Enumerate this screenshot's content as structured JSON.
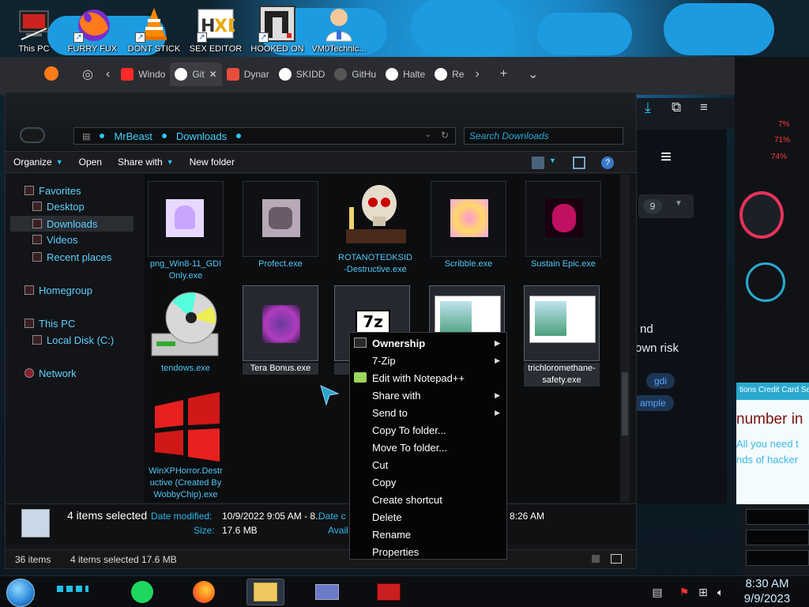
{
  "desktop": {
    "icons": [
      {
        "label": "This PC"
      },
      {
        "label": "FURRY FUX"
      },
      {
        "label": "DONT STICK"
      },
      {
        "label": "SEX EDITOR"
      },
      {
        "label": "HOOKED ON"
      },
      {
        "label": "VM0Technic..."
      }
    ]
  },
  "browser": {
    "tabs": [
      {
        "label": "Windo",
        "color": "#ff2a2a"
      },
      {
        "label": "Git",
        "color": "#ffffff",
        "active": true
      },
      {
        "label": "Dynar",
        "color": "#e84c3d"
      },
      {
        "label": "SKIDD",
        "color": "#ffffff"
      },
      {
        "label": "GitHu",
        "color": "#555555"
      },
      {
        "label": "Halte",
        "color": "#ffffff"
      },
      {
        "label": "Re",
        "color": "#ffffff"
      }
    ]
  },
  "right_page": {
    "pager_value": "9",
    "text_line1": "nd",
    "text_line2": "own risk",
    "chip1": "gdi",
    "chip2": "ample",
    "hud_header": "tions Credit Card Se",
    "hud_big": "number in",
    "hud_small1": "All you need t",
    "hud_small2": "nds of hacker",
    "pct1": "7%",
    "pct2": "71%",
    "pct3": "74%"
  },
  "explorer": {
    "address": {
      "crumbs": [
        "MrBeast",
        "Downloads"
      ]
    },
    "search_placeholder": "Search Downloads",
    "commands": {
      "organize": "Organize",
      "open": "Open",
      "share_with": "Share with",
      "new_folder": "New folder"
    },
    "nav": {
      "favorites": "Favorites",
      "desktop": "Desktop",
      "downloads": "Downloads",
      "videos": "Videos",
      "recent": "Recent places",
      "homegroup": "Homegroup",
      "thispc": "This PC",
      "localdisk": "Local Disk (C:)",
      "network": "Network"
    },
    "files": [
      {
        "label": "png_Win8-11_GDI Only.exe"
      },
      {
        "label": "Profect.exe"
      },
      {
        "label": "ROTANOTEDKSID-Destructive.exe"
      },
      {
        "label": "Scribble.exe"
      },
      {
        "label": "Sustain Epic.exe"
      },
      {
        "label": "tendows.exe"
      },
      {
        "label": "Tera Bonus.exe"
      },
      {
        "label": "t"
      },
      {
        "label": ""
      },
      {
        "label": "trichloromethane-safety.exe"
      },
      {
        "label": "WinXPHorror.Destructive (Created By WobbyChip).exe"
      }
    ],
    "details": {
      "count": "4 items selected",
      "date_modified_label": "Date modified:",
      "date_modified_value": "10/9/2022 9:05 AM - 8...",
      "date_created_label": "Date c",
      "date_created_value": "8:26 AM",
      "size_label": "Size:",
      "size_value": "17.6 MB",
      "avail_label": "Avail"
    },
    "status": {
      "total": "36 items",
      "selected": "4 items selected",
      "size": "17.6 MB"
    }
  },
  "context_menu": {
    "items": [
      {
        "label": "Ownership",
        "bold": true,
        "submenu": true
      },
      {
        "label": "7-Zip",
        "submenu": true
      },
      {
        "label": "Edit with Notepad++"
      },
      {
        "label": "Share with",
        "submenu": true
      },
      {
        "label": "Send to",
        "submenu": true
      },
      {
        "label": "Copy To folder..."
      },
      {
        "label": "Move To folder..."
      },
      {
        "label": "Cut"
      },
      {
        "label": "Copy"
      },
      {
        "label": "Create shortcut"
      },
      {
        "label": "Delete"
      },
      {
        "label": "Rename"
      },
      {
        "label": "Properties"
      }
    ]
  },
  "taskbar": {
    "time": "8:30 AM",
    "date": "9/9/2023"
  }
}
